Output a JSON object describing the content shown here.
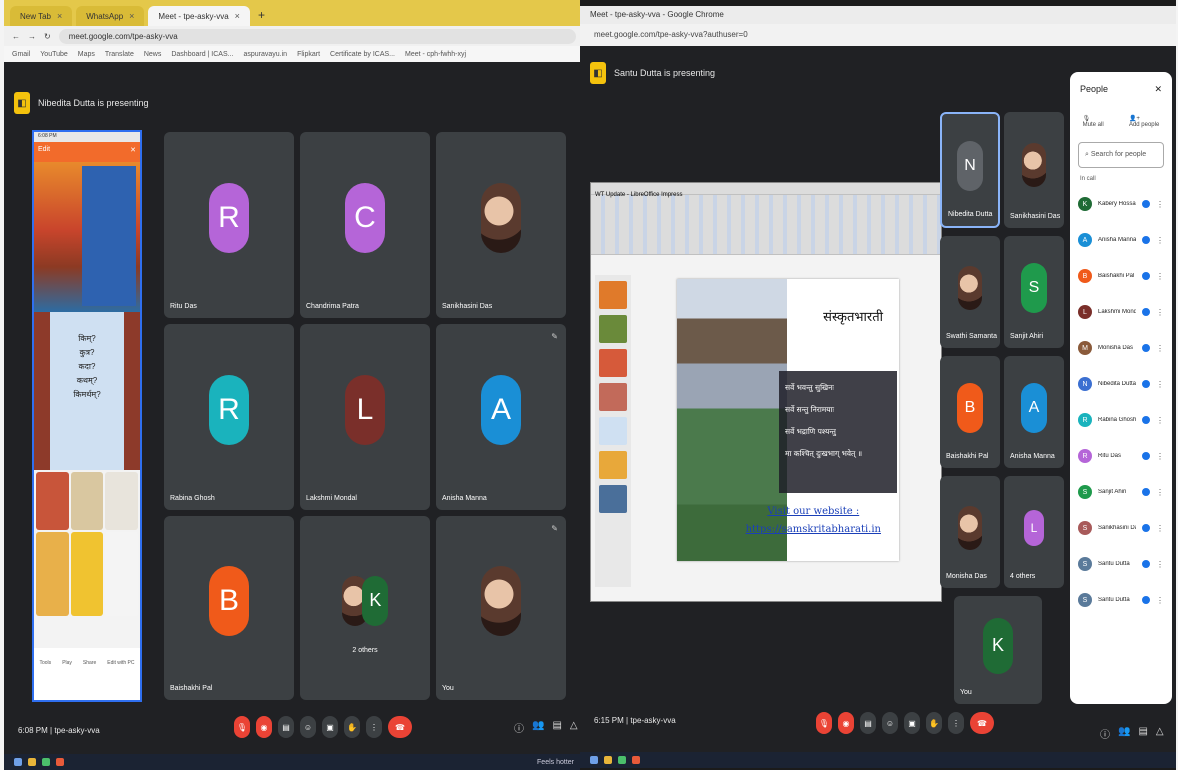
{
  "left": {
    "tabs": [
      "New Tab",
      "WhatsApp",
      "Meet - tpe-asky-vva"
    ],
    "url": "meet.google.com/tpe-asky-vva",
    "bookmarks": [
      "Gmail",
      "YouTube",
      "Maps",
      "Translate",
      "News",
      "Dashboard | ICAS...",
      "aspuravayu.in",
      "Flipkart",
      "Certificate by ICAS...",
      "Meet - cph-fwhh-xyj"
    ],
    "presenting": "Nibedita Dutta is presenting",
    "phone": {
      "edit_label": "Edit",
      "words": [
        "किम्?",
        "कुत्र?",
        "कदा?",
        "कथम्?",
        "किमर्थम्?"
      ],
      "nav": [
        "Tools",
        "Play",
        "Share",
        "Edit with PC"
      ]
    },
    "tiles": [
      {
        "name": "Ritu Das",
        "letter": "R",
        "color": "#b565d8"
      },
      {
        "name": "Chandrima Patra",
        "letter": "C",
        "color": "#b565d8"
      },
      {
        "name": "Sanikhasini Das",
        "letter": "",
        "color": ""
      },
      {
        "name": "Rabina Ghosh",
        "letter": "R",
        "color": "#1ab3bd"
      },
      {
        "name": "Lakshmi Mondal",
        "letter": "L",
        "color": "#7a2f2a"
      },
      {
        "name": "Anisha Manna",
        "letter": "A",
        "color": "#1a8fd6"
      },
      {
        "name": "Baishakhi Pal",
        "letter": "B",
        "color": "#f05a1a"
      },
      {
        "name": "2 others",
        "letter": "K",
        "color": "#1f6b35"
      },
      {
        "name": "You",
        "letter": "",
        "color": ""
      }
    ],
    "time": "6:08 PM | tpe-asky-vva",
    "taskbar": "Feels hotter"
  },
  "right": {
    "title": "Meet - tpe-asky-vva - Google Chrome",
    "url": "meet.google.com/tpe-asky-vva?authuser=0",
    "presenting": "Santu Dutta is presenting",
    "impress_title": "WT Update - LibreOffice Impress",
    "slide": {
      "heading": "संस्कृतभारती",
      "verse": [
        "सर्वे भवन्तु सुखिनः",
        "सर्वे सन्तु निरामयाः",
        "सर्वे भद्राणि पश्यन्तु",
        "मा कश्चित् दुःखभाग् भवेत् ॥"
      ],
      "visit": "Visit our website :",
      "link": "https://samskritabharati.in"
    },
    "tiles": [
      {
        "name": "Nibedita Dutta",
        "letter": "N",
        "color": "#3c4043"
      },
      {
        "name": "Sanikhasini Das",
        "letter": "",
        "color": ""
      },
      {
        "name": "Swathi Samanta",
        "letter": "",
        "color": ""
      },
      {
        "name": "Sanjit Ahiri",
        "letter": "S",
        "color": "#1f9a4c"
      },
      {
        "name": "Baishakhi Pal",
        "letter": "B",
        "color": "#f05a1a"
      },
      {
        "name": "Anisha Manna",
        "letter": "A",
        "color": "#1a8fd6"
      },
      {
        "name": "Monisha Das",
        "letter": "",
        "color": ""
      },
      {
        "name": "4 others",
        "letter": "L",
        "color": "#b565d8"
      },
      {
        "name": "You",
        "letter": "K",
        "color": "#1f6b35"
      }
    ],
    "people": {
      "title": "People",
      "mute_all": "Mute all",
      "add_people": "Add people",
      "search": "Search for people",
      "in_call": "In call",
      "list": [
        {
          "name": "Kabery Hossain (You) Meeting host",
          "letter": "K",
          "color": "#1f6b35"
        },
        {
          "name": "Anisha Manna",
          "letter": "A",
          "color": "#1a8fd6"
        },
        {
          "name": "Baishakhi Pal",
          "letter": "B",
          "color": "#f05a1a"
        },
        {
          "name": "Lakshmi Mondal",
          "letter": "L",
          "color": "#7a2f2a"
        },
        {
          "name": "Monisha Das",
          "letter": "M",
          "color": "#8a5a3a"
        },
        {
          "name": "Nibedita Dutta",
          "letter": "N",
          "color": "#3b6fd1"
        },
        {
          "name": "Rabina Ghosh",
          "letter": "R",
          "color": "#1ab3bd"
        },
        {
          "name": "Ritu Das",
          "letter": "R",
          "color": "#b565d8"
        },
        {
          "name": "Sanjit Ahiri",
          "letter": "S",
          "color": "#1f9a4c"
        },
        {
          "name": "Sanikhasini Das",
          "letter": "S",
          "color": "#a85a5a"
        },
        {
          "name": "Santu Dutta",
          "letter": "S",
          "color": "#5a7a9a"
        },
        {
          "name": "Santu Dutta",
          "letter": "S",
          "color": "#5a7a9a"
        }
      ]
    },
    "time": "6:15 PM | tpe-asky-vva"
  }
}
